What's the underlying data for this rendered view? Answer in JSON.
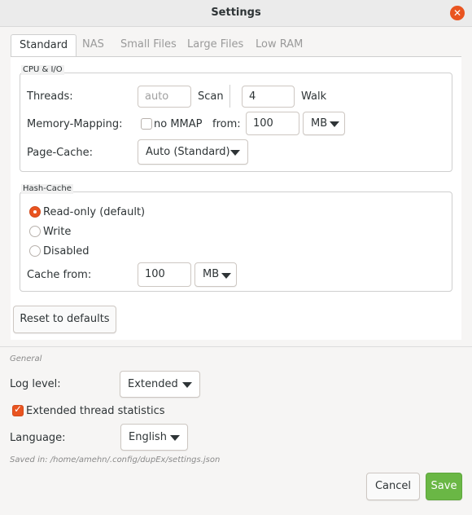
{
  "window": {
    "title": "Settings"
  },
  "tabs": [
    {
      "label": "Standard"
    },
    {
      "label": "NAS"
    },
    {
      "label": "Small Files"
    },
    {
      "label": "Large Files"
    },
    {
      "label": "Low RAM"
    }
  ],
  "cpu_io": {
    "frame_label": "CPU & I/O",
    "threads_label": "Threads:",
    "scan_placeholder": "auto",
    "scan_label": "Scan",
    "walk_value": "4",
    "walk_label": "Walk",
    "memory_mapping_label": "Memory-Mapping:",
    "no_mmap_label": "no MMAP",
    "no_mmap_checked": false,
    "from_label": "from:",
    "from_value": "100",
    "from_unit": "MB",
    "page_cache_label": "Page-Cache:",
    "page_cache_value": "Auto (Standard)"
  },
  "hash_cache": {
    "frame_label": "Hash-Cache",
    "options": [
      {
        "label": "Read-only (default)",
        "selected": true
      },
      {
        "label": "Write",
        "selected": false
      },
      {
        "label": "Disabled",
        "selected": false
      }
    ],
    "cache_from_label": "Cache from:",
    "cache_from_value": "100",
    "cache_from_unit": "MB"
  },
  "reset_label": "Reset to defaults",
  "general": {
    "section_label": "General",
    "log_level_label": "Log level:",
    "log_level_value": "Extended",
    "thread_stats_label": "Extended thread statistics",
    "thread_stats_checked": true,
    "language_label": "Language:",
    "language_value": "English",
    "saved_in": "Saved in: /home/amehn/.config/dupEx/settings.json"
  },
  "footer": {
    "cancel_label": "Cancel",
    "save_label": "Save"
  },
  "colors": {
    "accent": "#e95420",
    "save": "#6ab745"
  }
}
